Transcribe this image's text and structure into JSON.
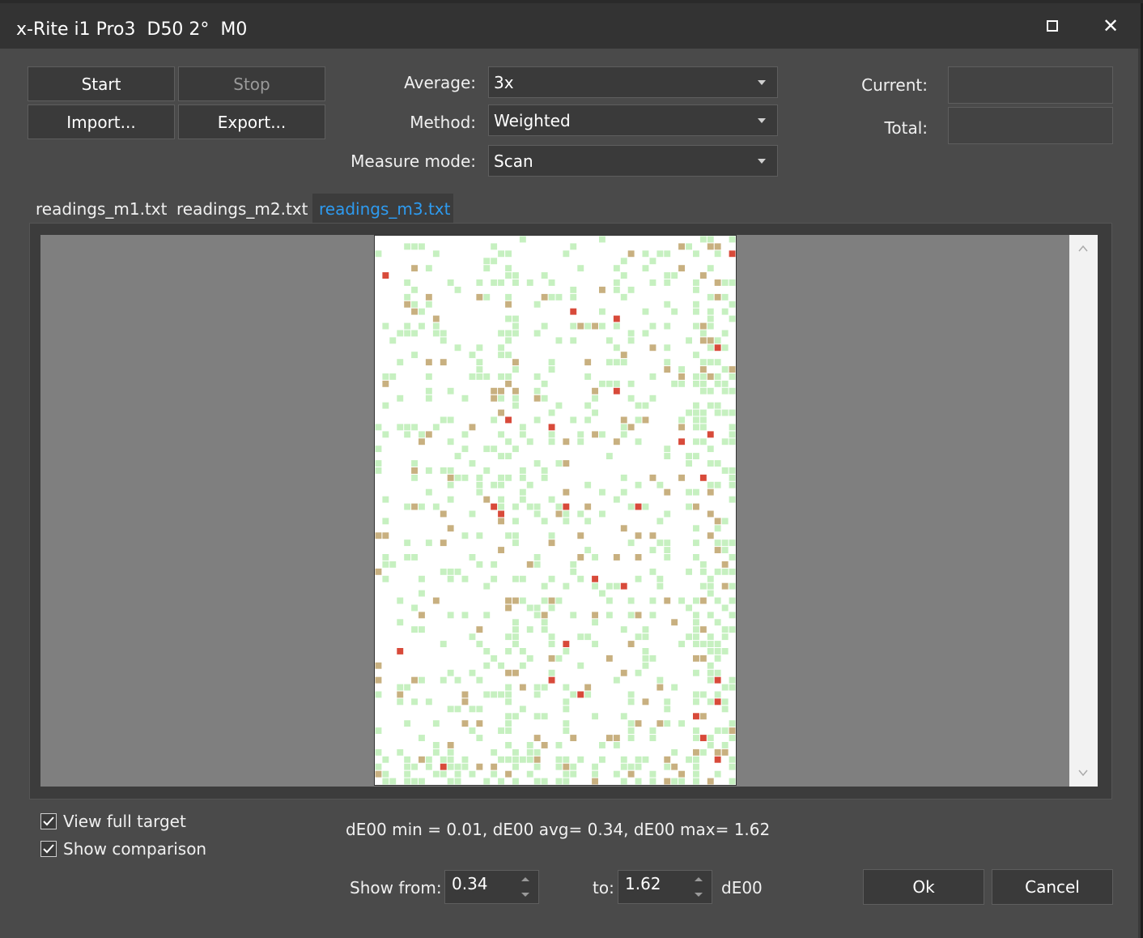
{
  "window": {
    "title": "x-Rite i1 Pro3  D50 2°  M0",
    "maximize_icon": "maximize-icon",
    "close_glyph": "✕"
  },
  "actions": {
    "start_label": "Start",
    "stop_label": "Stop",
    "import_label": "Import...",
    "export_label": "Export..."
  },
  "settings": {
    "average_label": "Average:",
    "average_value": "3x",
    "method_label": "Method:",
    "method_value": "Weighted",
    "measure_mode_label": "Measure mode:",
    "measure_mode_value": "Scan"
  },
  "progress": {
    "current_label": "Current:",
    "current_value": "",
    "total_label": "Total:",
    "total_value": ""
  },
  "tabs": [
    {
      "label": "readings_m1.txt",
      "active": false
    },
    {
      "label": "readings_m2.txt",
      "active": false
    },
    {
      "label": "readings_m3.txt",
      "active": true
    }
  ],
  "target": {
    "description_colors": {
      "background": "#ffffff",
      "low_de": "#c6f0c0",
      "mid_de": "#c8b080",
      "high_de": "#d84a3a"
    },
    "columns": 50,
    "rows": 76
  },
  "options": {
    "view_full_target_label": "View full target",
    "view_full_target_checked": true,
    "show_comparison_label": "Show comparison",
    "show_comparison_checked": true
  },
  "stats": {
    "text": "dE00 min = 0.01, dE00 avg= 0.34, dE00 max= 1.62"
  },
  "filter": {
    "show_from_label": "Show from:",
    "from_value": "0.34",
    "to_label": "to:",
    "to_value": "1.62",
    "unit_label": "dE00"
  },
  "dialog": {
    "ok_label": "Ok",
    "cancel_label": "Cancel"
  }
}
